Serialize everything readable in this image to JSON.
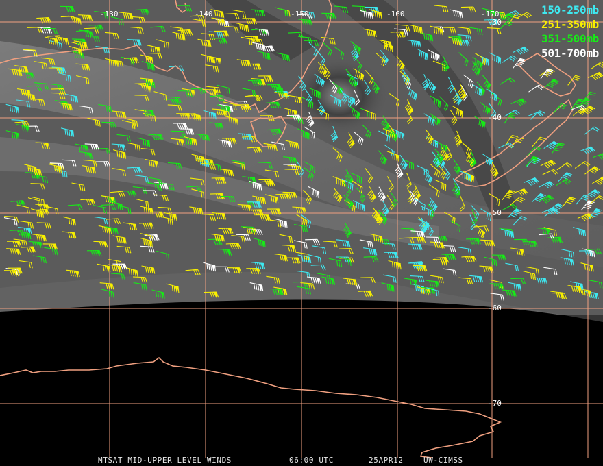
{
  "map": {
    "longitude_labels": [
      "-130",
      "-140",
      "-150",
      "-160",
      "-170"
    ],
    "latitude_labels": [
      "-30",
      "-40",
      "-50",
      "-60",
      "-70"
    ],
    "colors": {
      "grid": "#f0a080",
      "coast": "#f0a080",
      "space_black": "#000000"
    }
  },
  "legend": {
    "items": [
      {
        "label": "150-250mb",
        "color": "#3ee8f0"
      },
      {
        "label": "251-350mb",
        "color": "#f8f000"
      },
      {
        "label": "351-500mb",
        "color": "#18e818"
      },
      {
        "label": "501-700mb",
        "color": "#ffffff"
      }
    ]
  },
  "footer": {
    "product": "MTSAT MID-UPPER LEVEL WINDS",
    "time": "06:00 UTC",
    "date": "25APR12",
    "source": "UW-CIMSS"
  }
}
